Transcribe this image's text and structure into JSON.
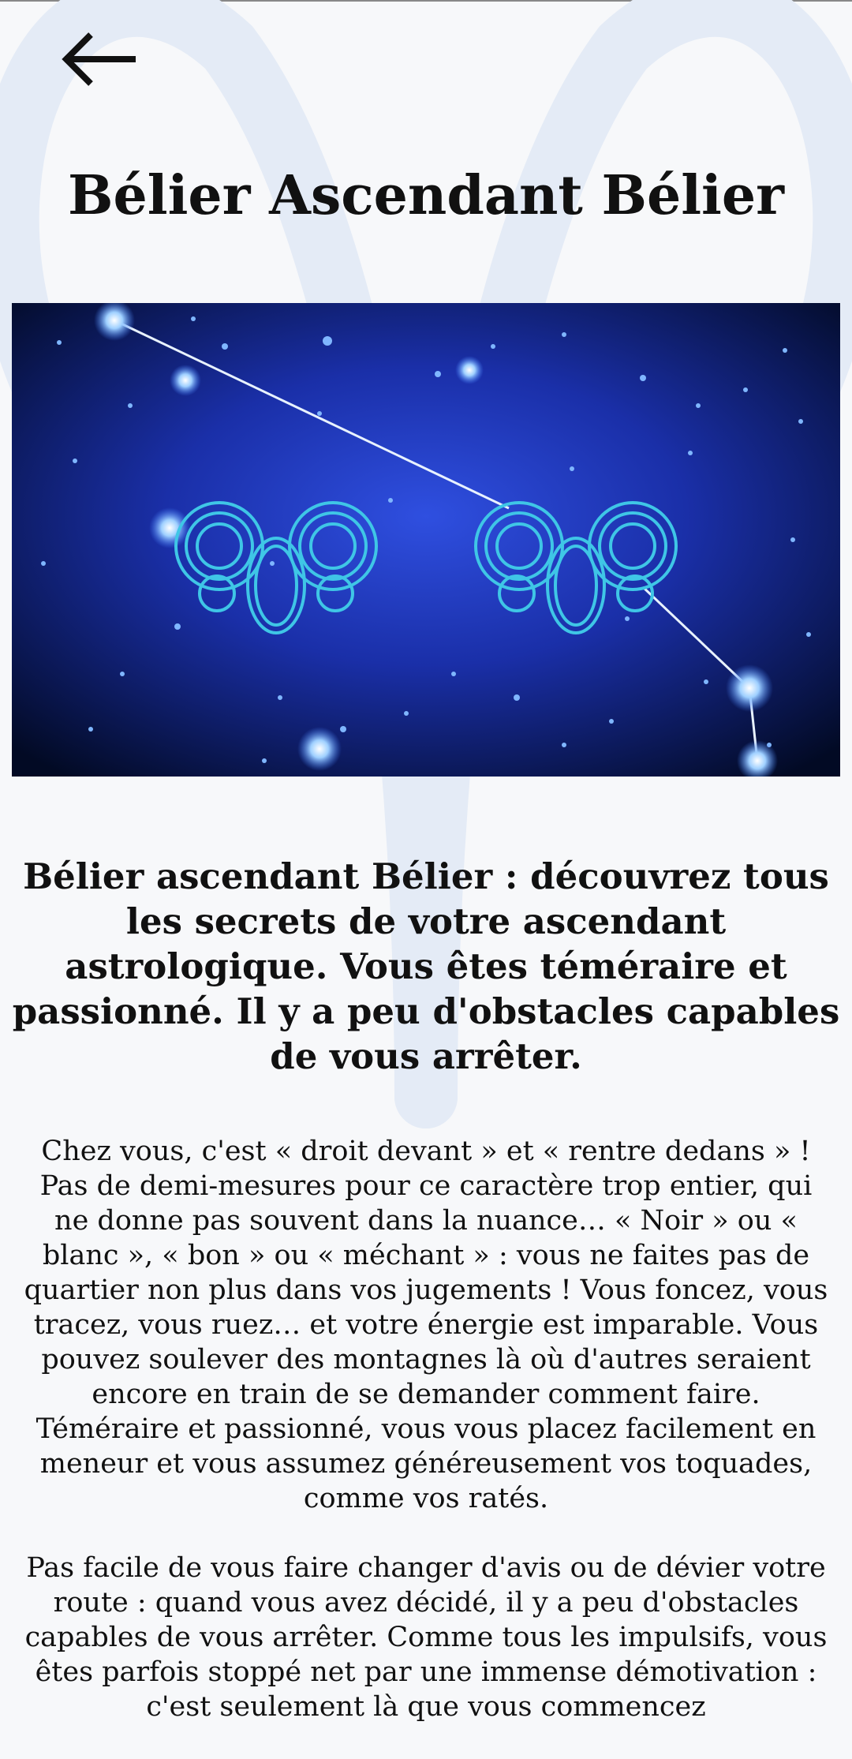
{
  "header": {
    "back_icon": "arrow-left-icon",
    "title": "Bélier Ascendant Bélier"
  },
  "hero_image": {
    "description_icon": "aries-rams-constellation-image",
    "colors": {
      "sky_center": "#2f4fe0",
      "sky_edge": "#020a24",
      "ram": "#3fc6e6"
    }
  },
  "article": {
    "subtitle": "Bélier ascendant Bélier : découvrez tous les secrets de votre ascendant astrologique. Vous êtes téméraire et passionné. Il y a peu d'obstacles capables de vous arrêter.",
    "paragraphs": [
      "Chez vous, c'est « droit devant » et « rentre dedans » ! Pas de demi-mesures pour ce caractère trop entier, qui ne donne pas souvent dans la nuance… « Noir » ou « blanc », « bon » ou « méchant » : vous ne faites pas de quartier non plus dans vos jugements ! Vous foncez, vous tracez, vous ruez… et votre énergie est imparable. Vous pouvez soulever des montagnes là où d'autres seraient encore en train de se demander comment faire. Téméraire et passionné, vous vous placez facilement en meneur et vous assumez généreusement vos toquades, comme vos ratés.",
      "Pas facile de vous faire changer d'avis ou de dévier votre route : quand vous avez décidé, il y a peu d'obstacles capables de vous arrêter. Comme tous les impulsifs, vous êtes parfois stoppé net par une immense démotivation : c'est seulement là que vous commencez"
    ]
  },
  "background": {
    "glyph_icon": "aries-symbol-icon",
    "glyph_color": "#e4ebf6"
  }
}
